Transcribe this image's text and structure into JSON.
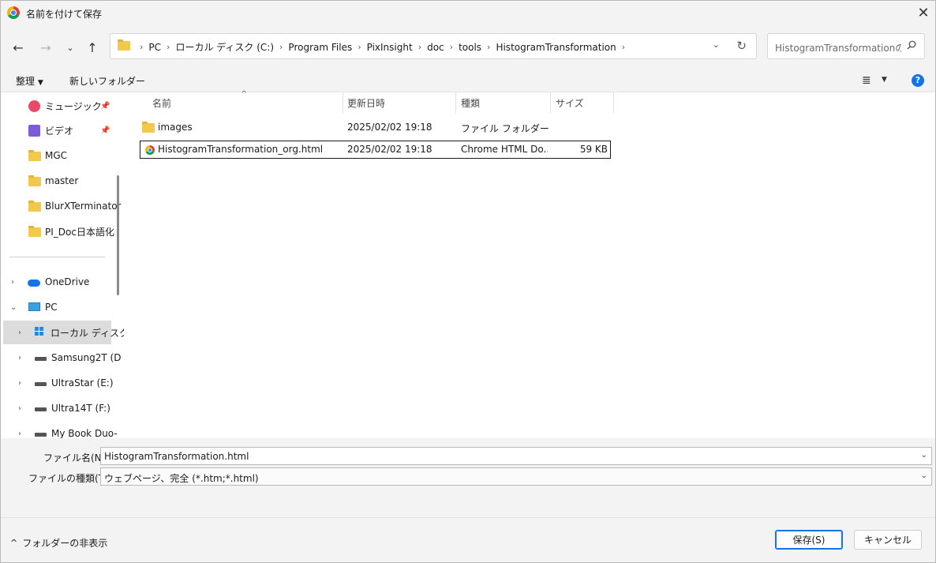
{
  "window": {
    "title": "名前を付けて保存"
  },
  "address": {
    "crumbs": [
      "PC",
      "ローカル ディスク (C:)",
      "Program Files",
      "PixInsight",
      "doc",
      "tools",
      "HistogramTransformation"
    ]
  },
  "search": {
    "placeholder": "HistogramTransformationの..."
  },
  "toolbar": {
    "organize_label": "整理",
    "new_folder_label": "新しいフォルダー",
    "help_label": "?"
  },
  "nav": {
    "items": [
      {
        "label": "ミュージック",
        "icon": "music-icon"
      },
      {
        "label": "ビデオ",
        "icon": "video-icon"
      },
      {
        "label": "MGC",
        "icon": "folder-icon"
      },
      {
        "label": "master",
        "icon": "folder-icon"
      },
      {
        "label": "BlurXTerminator",
        "icon": "folder-icon"
      },
      {
        "label": "PI_Doc日本語化",
        "icon": "folder-icon"
      }
    ],
    "tree": [
      {
        "label": "OneDrive",
        "icon": "onedrive-icon"
      },
      {
        "label": "PC",
        "icon": "pc-icon"
      },
      {
        "label": "ローカル ディスク",
        "icon": "windows-drive-icon"
      },
      {
        "label": "Samsung2T (D",
        "icon": "drive-icon"
      },
      {
        "label": "UltraStar (E:)",
        "icon": "drive-icon"
      },
      {
        "label": "Ultra14T (F:)",
        "icon": "drive-icon"
      },
      {
        "label": "My Book Duo-",
        "icon": "drive-icon"
      }
    ]
  },
  "columns": {
    "name": "名前",
    "modified": "更新日時",
    "type": "種類",
    "size": "サイズ"
  },
  "files": [
    {
      "name": "images",
      "modified": "2025/02/02 19:18",
      "type": "ファイル フォルダー",
      "size": "",
      "icon": "folder-icon"
    },
    {
      "name": "HistogramTransformation_org.html",
      "modified": "2025/02/02 19:18",
      "type": "Chrome HTML Do...",
      "size": "59 KB",
      "icon": "chrome-icon"
    }
  ],
  "form": {
    "filename_label": "ファイル名(N):",
    "filename_value": "HistogramTransformation.html",
    "filetype_label": "ファイルの種類(T):",
    "filetype_value": "ウェブページ、完全 (*.htm;*.html)"
  },
  "footer": {
    "toggle_label": "フォルダーの非表示",
    "save_label": "保存(S)",
    "cancel_label": "キャンセル"
  },
  "colors": {
    "accent": "#1473e6",
    "folder": "#f2c94c"
  }
}
